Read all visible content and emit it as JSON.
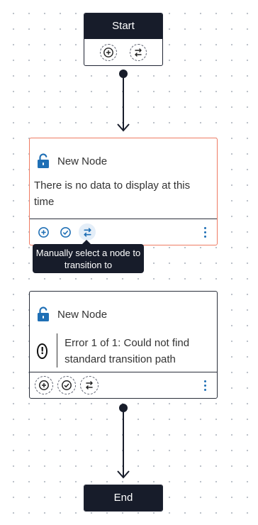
{
  "start": {
    "label": "Start",
    "actions": [
      {
        "icon": "add-circle-icon",
        "tooltip": ""
      },
      {
        "icon": "transition-icon",
        "tooltip": ""
      }
    ]
  },
  "node1": {
    "title": "New Node",
    "message": "There is no data to display at this time",
    "status": "selected",
    "actions": [
      {
        "icon": "add-circle-icon"
      },
      {
        "icon": "check-circle-icon"
      },
      {
        "icon": "transition-icon"
      }
    ]
  },
  "tooltip": {
    "text": "Manually select a node to transition to"
  },
  "node2": {
    "title": "New Node",
    "error_message": "Error 1 of 1: Could not find standard transition path",
    "actions": [
      {
        "icon": "add-circle-icon"
      },
      {
        "icon": "check-circle-icon"
      },
      {
        "icon": "transition-icon"
      }
    ]
  },
  "end": {
    "label": "End"
  },
  "colors": {
    "dark": "#171c2a",
    "accent_blue": "#1f6fb5",
    "selected_border": "#ef7b63",
    "canvas_dot": "#b9bfc7"
  }
}
